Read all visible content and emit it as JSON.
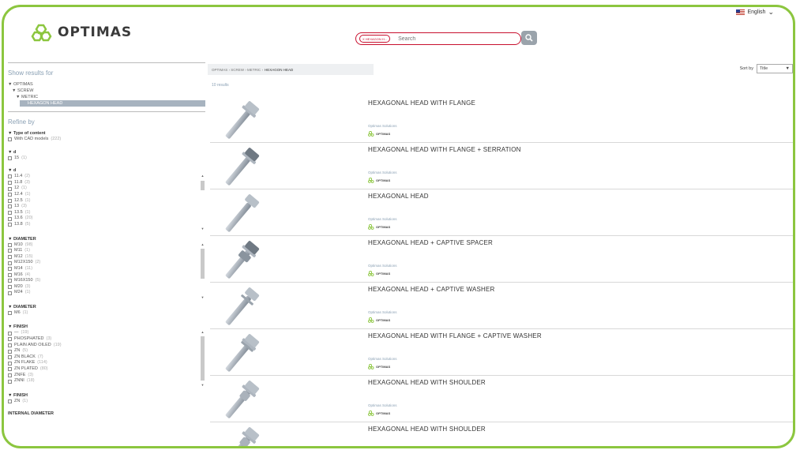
{
  "header": {
    "logo_text": "OPTIMAS",
    "language": "English",
    "search": {
      "chip": "X HEXAGON H...",
      "placeholder": "Search"
    }
  },
  "colors": {
    "accent_green": "#8cc63f",
    "chip_red": "#c8102e",
    "selected_bg": "#a7b3bf"
  },
  "sidebar": {
    "show_results_title": "Show results for",
    "tree": [
      "▼ OPTIMAS",
      "▼ SCREW",
      "▼ METRIC"
    ],
    "tree_selected": "HEXAGON HEAD",
    "refine_title": "Refine by",
    "content_group": {
      "title": "▼ Type of content",
      "option": "With CAD models",
      "count": "(222)"
    },
    "d1": {
      "title": "▼ d",
      "options": [
        {
          "label": "15",
          "count": "(1)"
        }
      ]
    },
    "d2": {
      "title": "▼ d",
      "options": [
        {
          "label": "11.4",
          "count": "(2)"
        },
        {
          "label": "11.8",
          "count": "(3)"
        },
        {
          "label": "12",
          "count": "(1)"
        },
        {
          "label": "12.4",
          "count": "(1)"
        },
        {
          "label": "12.5",
          "count": "(1)"
        },
        {
          "label": "13",
          "count": "(3)"
        },
        {
          "label": "13.5",
          "count": "(1)"
        },
        {
          "label": "13.6",
          "count": "(20)"
        },
        {
          "label": "13.8",
          "count": "(5)"
        }
      ]
    },
    "diameter1": {
      "title": "▼ DIAMETER",
      "options": [
        {
          "label": "M10",
          "count": "(98)"
        },
        {
          "label": "M11",
          "count": "(1)"
        },
        {
          "label": "M12",
          "count": "(15)"
        },
        {
          "label": "M12X150",
          "count": "(2)"
        },
        {
          "label": "M14",
          "count": "(11)"
        },
        {
          "label": "M16",
          "count": "(4)"
        },
        {
          "label": "M16X150",
          "count": "(5)"
        },
        {
          "label": "M20",
          "count": "(3)"
        },
        {
          "label": "M24",
          "count": "(1)"
        }
      ]
    },
    "diameter2": {
      "title": "▼ DIAMETER",
      "options": [
        {
          "label": "M6",
          "count": "(1)"
        }
      ]
    },
    "finish1": {
      "title": "▼ FINISH",
      "options": [
        {
          "label": "—",
          "count": "(19)"
        },
        {
          "label": "PHOSPHATED",
          "count": "(3)"
        },
        {
          "label": "PLAIN AND OILED",
          "count": "(19)"
        },
        {
          "label": "ZN",
          "count": "(5)"
        },
        {
          "label": "ZN BLACK",
          "count": "(7)"
        },
        {
          "label": "ZN FLAKE",
          "count": "(114)"
        },
        {
          "label": "ZN PLATED",
          "count": "(80)"
        },
        {
          "label": "ZNFE",
          "count": "(3)"
        },
        {
          "label": "ZNNI",
          "count": "(18)"
        }
      ]
    },
    "finish2": {
      "title": "▼ FINISH",
      "options": [
        {
          "label": "ZN",
          "count": "(1)"
        }
      ]
    },
    "internal_diameter_title": "INTERNAL DIAMETER"
  },
  "main": {
    "breadcrumb": "OPTIMAS › SCREW › METRIC ›",
    "breadcrumb_last": "HEXAGON HEAD",
    "sort_label": "Sort by",
    "sort_value": "Title",
    "results_count": "10 results",
    "results": [
      {
        "title": "HEXAGONAL HEAD WITH FLANGE",
        "source": "Optimas Solutions",
        "brand": "OPTIMAS",
        "icon": "bolt-flange-icon"
      },
      {
        "title": "HEXAGONAL HEAD WITH FLANGE + SERRATION",
        "source": "Optimas Solutions",
        "brand": "OPTIMAS",
        "icon": "bolt-serrated-icon"
      },
      {
        "title": "HEXAGONAL HEAD",
        "source": "Optimas Solutions",
        "brand": "OPTIMAS",
        "icon": "bolt-hex-icon"
      },
      {
        "title": "HEXAGONAL HEAD + CAPTIVE SPACER",
        "source": "Optimas Solutions",
        "brand": "OPTIMAS",
        "icon": "bolt-spacer-icon"
      },
      {
        "title": "HEXAGONAL HEAD + CAPTIVE WASHER",
        "source": "Optimas Solutions",
        "brand": "OPTIMAS",
        "icon": "bolt-washer-icon"
      },
      {
        "title": "HEXAGONAL HEAD WITH FLANGE + CAPTIVE WASHER",
        "source": "Optimas Solutions",
        "brand": "OPTIMAS",
        "icon": "bolt-flange-washer-icon"
      },
      {
        "title": "HEXAGONAL HEAD WITH SHOULDER",
        "source": "Optimas Solutions",
        "brand": "OPTIMAS",
        "icon": "bolt-shoulder-icon"
      },
      {
        "title": "HEXAGONAL HEAD WITH SHOULDER",
        "source": "Optimas Solutions",
        "brand": "OPTIMAS",
        "icon": "bolt-shoulder-icon"
      }
    ]
  }
}
